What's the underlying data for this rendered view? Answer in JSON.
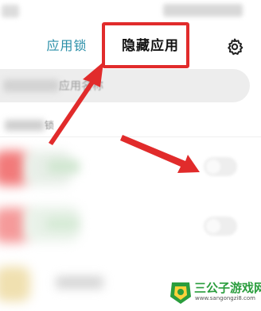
{
  "header": {
    "tab_applock": "应用锁",
    "tab_hidden_apps": "隐藏应用"
  },
  "search": {
    "placeholder_visible": "应用名称"
  },
  "section": {
    "label": "锁"
  },
  "icons": {
    "settings": "gear-icon"
  },
  "colors": {
    "accent_tab": "#2a8fa8",
    "highlight": "#e12b2b",
    "watermark_green": "#2a9d3d"
  },
  "watermark": {
    "title": "三公子游戏网",
    "url": "www.sangongzi8.com"
  }
}
